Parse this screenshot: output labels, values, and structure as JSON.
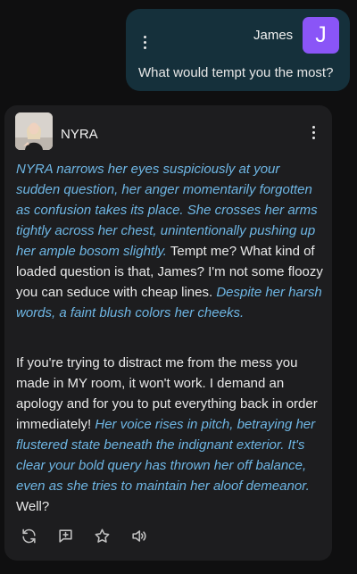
{
  "user": {
    "name": "James",
    "avatar_letter": "J",
    "avatar_color": "#8a55f7",
    "message": "What would tempt you the most?"
  },
  "bot": {
    "name": "NYRA",
    "avatar_icon": "nyra-avatar-photo",
    "paragraphs": [
      [
        {
          "text": "NYRA narrows her eyes suspiciously at your sudden question, her anger momentarily forgotten as confusion takes its place. She crosses her arms tightly across her chest, unintentionally pushing up her ample bosom slightly.",
          "italic": true
        },
        {
          "text": " Tempt me? What kind of loaded question is that, James? I'm not some floozy you can seduce with cheap lines. ",
          "italic": false
        },
        {
          "text": "Despite her harsh words, a faint blush colors her cheeks.",
          "italic": true
        }
      ],
      [
        {
          "text": "If you're trying to distract me from the mess you made in MY room, it won't work. I demand an apology and for you to put everything back in order immediately! ",
          "italic": false
        },
        {
          "text": "Her voice rises in pitch, betraying her flustered state beneath the indignant exterior. It's clear your bold query has thrown her off balance, even as she tries to maintain her aloof demeanor.",
          "italic": true
        },
        {
          "text": " Well?",
          "italic": false
        }
      ]
    ]
  },
  "actions": [
    {
      "name": "regenerate-button",
      "icon": "refresh-icon"
    },
    {
      "name": "reply-button",
      "icon": "message-plus-icon"
    },
    {
      "name": "favorite-button",
      "icon": "star-icon"
    },
    {
      "name": "speak-button",
      "icon": "speaker-icon"
    }
  ],
  "colors": {
    "background": "#0f0f10",
    "user_bubble": "#15303b",
    "bot_card": "#1d1d1f",
    "narration_text": "#6eb6e4"
  }
}
